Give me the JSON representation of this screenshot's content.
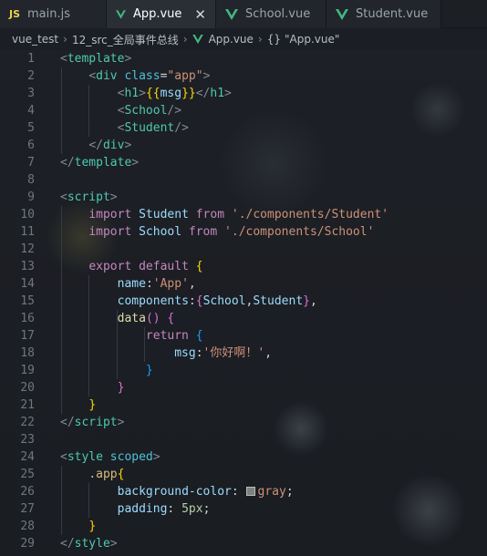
{
  "tabs": [
    {
      "label": "main.js",
      "icon": "js-icon",
      "active": false
    },
    {
      "label": "App.vue",
      "icon": "vue-icon",
      "active": true
    },
    {
      "label": "School.vue",
      "icon": "vue-icon",
      "active": false
    },
    {
      "label": "Student.vue",
      "icon": "vue-icon",
      "active": false
    }
  ],
  "tab_icons": {
    "js": "JS",
    "close": "✕"
  },
  "breadcrumb": {
    "items": [
      "vue_test",
      "12_src_全局事件总线",
      "App.vue",
      "\"App.vue\""
    ],
    "brace": "{}"
  },
  "colors": {
    "vue": "#41b883",
    "js": "#e8d44d",
    "tag": "#4ec9b0",
    "string": "#ce9178"
  },
  "lines": [
    {
      "n": "1",
      "code": [
        [
          "t-punc",
          "<"
        ],
        [
          "t-tag",
          "template"
        ],
        [
          "t-punc",
          ">"
        ]
      ]
    },
    {
      "n": "2",
      "code": [
        [
          "t-plain",
          "    "
        ],
        [
          "t-punc",
          "<"
        ],
        [
          "t-tag",
          "div"
        ],
        [
          "t-plain",
          " "
        ],
        [
          "t-attr",
          "class"
        ],
        [
          "t-plain",
          "="
        ],
        [
          "t-str",
          "\"app\""
        ],
        [
          "t-punc",
          ">"
        ]
      ]
    },
    {
      "n": "3",
      "code": [
        [
          "t-plain",
          "        "
        ],
        [
          "t-punc",
          "<"
        ],
        [
          "t-tag",
          "h1"
        ],
        [
          "t-punc",
          ">"
        ],
        [
          "t-brace",
          "{{"
        ],
        [
          "t-id",
          "msg"
        ],
        [
          "t-brace",
          "}}"
        ],
        [
          "t-punc",
          "</"
        ],
        [
          "t-tag",
          "h1"
        ],
        [
          "t-punc",
          ">"
        ]
      ]
    },
    {
      "n": "4",
      "code": [
        [
          "t-plain",
          "        "
        ],
        [
          "t-punc",
          "<"
        ],
        [
          "t-tag",
          "School"
        ],
        [
          "t-punc",
          "/>"
        ]
      ]
    },
    {
      "n": "5",
      "code": [
        [
          "t-plain",
          "        "
        ],
        [
          "t-punc",
          "<"
        ],
        [
          "t-tag",
          "Student"
        ],
        [
          "t-punc",
          "/>"
        ]
      ]
    },
    {
      "n": "6",
      "code": [
        [
          "t-plain",
          "    "
        ],
        [
          "t-punc",
          "</"
        ],
        [
          "t-tag",
          "div"
        ],
        [
          "t-punc",
          ">"
        ]
      ]
    },
    {
      "n": "7",
      "code": [
        [
          "t-punc",
          "</"
        ],
        [
          "t-tag",
          "template"
        ],
        [
          "t-punc",
          ">"
        ]
      ]
    },
    {
      "n": "8",
      "code": []
    },
    {
      "n": "9",
      "code": [
        [
          "t-punc",
          "<"
        ],
        [
          "t-tag",
          "script"
        ],
        [
          "t-punc",
          ">"
        ]
      ]
    },
    {
      "n": "10",
      "code": [
        [
          "t-plain",
          "    "
        ],
        [
          "t-key",
          "import"
        ],
        [
          "t-plain",
          " "
        ],
        [
          "t-id",
          "Student"
        ],
        [
          "t-plain",
          " "
        ],
        [
          "t-key",
          "from"
        ],
        [
          "t-plain",
          " "
        ],
        [
          "t-str",
          "'./components/Student'"
        ]
      ]
    },
    {
      "n": "11",
      "code": [
        [
          "t-plain",
          "    "
        ],
        [
          "t-key",
          "import"
        ],
        [
          "t-plain",
          " "
        ],
        [
          "t-id",
          "School"
        ],
        [
          "t-plain",
          " "
        ],
        [
          "t-key",
          "from"
        ],
        [
          "t-plain",
          " "
        ],
        [
          "t-str",
          "'./components/School'"
        ]
      ]
    },
    {
      "n": "12",
      "code": []
    },
    {
      "n": "13",
      "code": [
        [
          "t-plain",
          "    "
        ],
        [
          "t-key",
          "export"
        ],
        [
          "t-plain",
          " "
        ],
        [
          "t-key",
          "default"
        ],
        [
          "t-plain",
          " "
        ],
        [
          "t-brace",
          "{"
        ]
      ]
    },
    {
      "n": "14",
      "code": [
        [
          "t-plain",
          "        "
        ],
        [
          "t-prop",
          "name"
        ],
        [
          "t-plain",
          ":"
        ],
        [
          "t-str",
          "'App'"
        ],
        [
          "t-plain",
          ","
        ]
      ]
    },
    {
      "n": "15",
      "code": [
        [
          "t-plain",
          "        "
        ],
        [
          "t-prop",
          "components"
        ],
        [
          "t-plain",
          ":"
        ],
        [
          "t-brace2",
          "{"
        ],
        [
          "t-id",
          "School"
        ],
        [
          "t-plain",
          ","
        ],
        [
          "t-id",
          "Student"
        ],
        [
          "t-brace2",
          "}"
        ],
        [
          "t-plain",
          ","
        ]
      ]
    },
    {
      "n": "16",
      "code": [
        [
          "t-plain",
          "        "
        ],
        [
          "t-fn",
          "data"
        ],
        [
          "t-brace2",
          "()"
        ],
        [
          "t-plain",
          " "
        ],
        [
          "t-brace2",
          "{"
        ]
      ]
    },
    {
      "n": "17",
      "code": [
        [
          "t-plain",
          "            "
        ],
        [
          "t-key",
          "return"
        ],
        [
          "t-plain",
          " "
        ],
        [
          "t-brace3",
          "{"
        ]
      ]
    },
    {
      "n": "18",
      "code": [
        [
          "t-plain",
          "                "
        ],
        [
          "t-prop",
          "msg"
        ],
        [
          "t-plain",
          ":"
        ],
        [
          "t-str",
          "'你好啊！'"
        ],
        [
          "t-plain",
          ","
        ]
      ]
    },
    {
      "n": "19",
      "code": [
        [
          "t-plain",
          "            "
        ],
        [
          "t-brace3",
          "}"
        ]
      ]
    },
    {
      "n": "20",
      "code": [
        [
          "t-plain",
          "        "
        ],
        [
          "t-brace2",
          "}"
        ]
      ]
    },
    {
      "n": "21",
      "code": [
        [
          "t-plain",
          "    "
        ],
        [
          "t-brace",
          "}"
        ]
      ]
    },
    {
      "n": "22",
      "code": [
        [
          "t-punc",
          "</"
        ],
        [
          "t-tag",
          "script"
        ],
        [
          "t-punc",
          ">"
        ]
      ]
    },
    {
      "n": "23",
      "code": []
    },
    {
      "n": "24",
      "code": [
        [
          "t-punc",
          "<"
        ],
        [
          "t-tag",
          "style"
        ],
        [
          "t-plain",
          " "
        ],
        [
          "t-attr",
          "scoped"
        ],
        [
          "t-punc",
          ">"
        ]
      ]
    },
    {
      "n": "25",
      "code": [
        [
          "t-plain",
          "    "
        ],
        [
          "t-css",
          ".app"
        ],
        [
          "t-brace",
          "{"
        ]
      ]
    },
    {
      "n": "26",
      "code": [
        [
          "t-plain",
          "        "
        ],
        [
          "t-prop",
          "background-color"
        ],
        [
          "t-plain",
          ": "
        ],
        [
          "swatch",
          ""
        ],
        [
          "t-str",
          "gray"
        ],
        [
          "t-plain",
          ";"
        ]
      ]
    },
    {
      "n": "27",
      "code": [
        [
          "t-plain",
          "        "
        ],
        [
          "t-prop",
          "padding"
        ],
        [
          "t-plain",
          ": "
        ],
        [
          "t-num",
          "5px"
        ],
        [
          "t-plain",
          ";"
        ]
      ]
    },
    {
      "n": "28",
      "code": [
        [
          "t-plain",
          "    "
        ],
        [
          "t-brace",
          "}"
        ]
      ]
    },
    {
      "n": "29",
      "code": [
        [
          "t-punc",
          "</"
        ],
        [
          "t-tag",
          "style"
        ],
        [
          "t-punc",
          ">"
        ]
      ]
    }
  ]
}
